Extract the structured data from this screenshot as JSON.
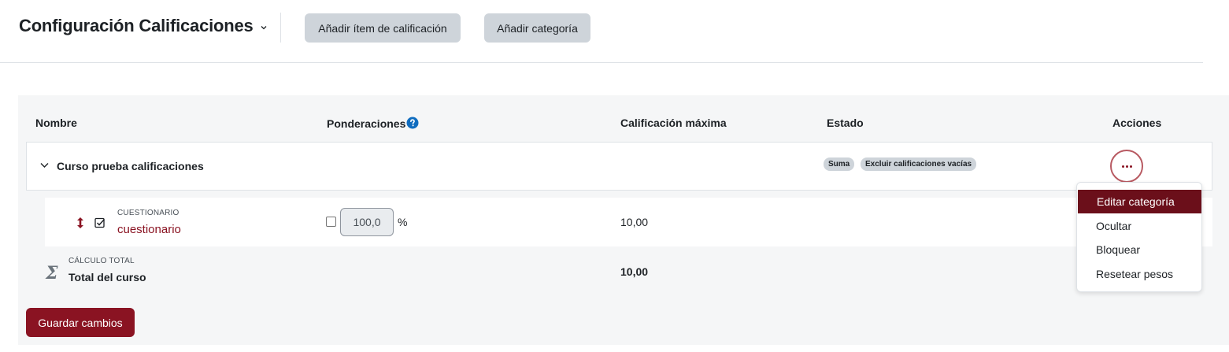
{
  "header": {
    "title": "Configuración Calificaciones",
    "add_item_label": "Añadir ítem de calificación",
    "add_category_label": "Añadir categoría"
  },
  "table": {
    "columns": {
      "name": "Nombre",
      "weights": "Ponderaciones",
      "max_grade": "Calificación máxima",
      "status": "Estado",
      "actions": "Acciones"
    },
    "category": {
      "name": "Curso prueba calificaciones",
      "badges": [
        "Suma",
        "Excluir calificaciones vacías"
      ]
    },
    "item": {
      "type": "CUESTIONARIO",
      "name": "cuestionario",
      "weight_value": "100,0",
      "weight_unit": "%",
      "weight_checked": false,
      "max_grade": "10,00"
    },
    "total": {
      "type": "CÁLCULO TOTAL",
      "name": "Total del curso",
      "max_grade": "10,00"
    }
  },
  "save_label": "Guardar cambios",
  "actions_menu": {
    "items": [
      "Editar categoría",
      "Ocultar",
      "Bloquear",
      "Resetear pesos"
    ],
    "active_index": 0
  },
  "colors": {
    "brand": "#8a1322",
    "menu_active": "#6b0f1a",
    "help_icon": "#0f6cbf",
    "grey_button": "#ced4da",
    "table_bg": "#f5f6f7"
  }
}
